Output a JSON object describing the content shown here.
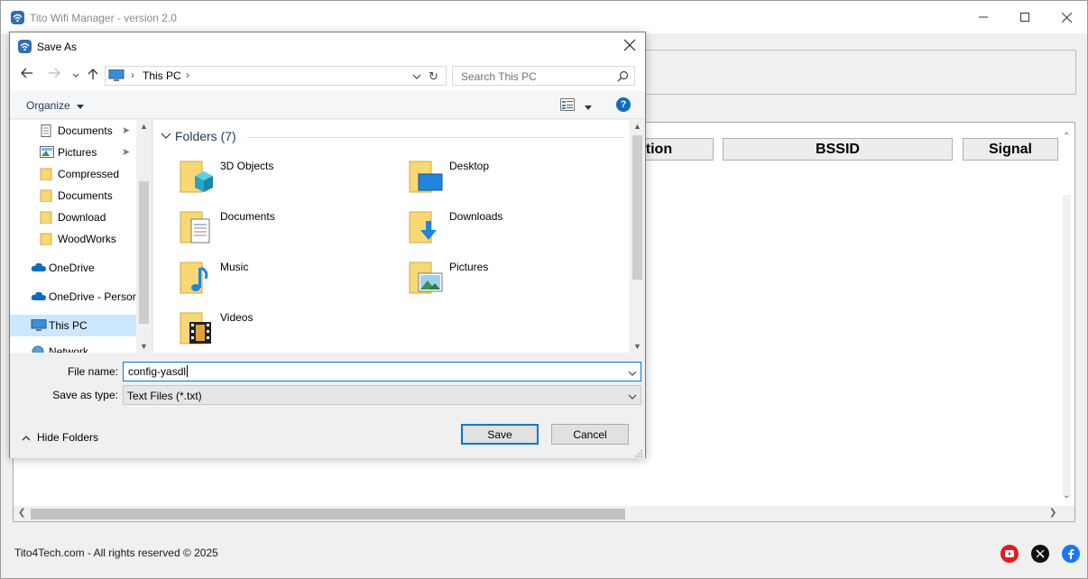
{
  "app": {
    "title": "Tito Wifi Manager - version 2.0",
    "grid_headers": {
      "description_partial": "ption",
      "bssid": "BSSID",
      "signal": "Signal"
    },
    "footer": "Tito4Tech.com - All rights reserved © 2025",
    "social": [
      "youtube-icon",
      "x-icon",
      "facebook-icon"
    ]
  },
  "dialog": {
    "title": "Save As",
    "address": {
      "location": "This PC"
    },
    "search_placeholder": "Search This PC",
    "organize_label": "Organize",
    "nav_tree": [
      {
        "label": "Documents",
        "icon": "documents-icon",
        "pinned": true
      },
      {
        "label": "Pictures",
        "icon": "pictures-icon",
        "pinned": true
      },
      {
        "label": "Compressed",
        "icon": "folder-icon",
        "pinned": false
      },
      {
        "label": "Documents",
        "icon": "folder-icon",
        "pinned": false
      },
      {
        "label": "Download",
        "icon": "folder-icon",
        "pinned": false
      },
      {
        "label": "WoodWorks",
        "icon": "folder-icon",
        "pinned": false
      },
      {
        "label": "OneDrive",
        "icon": "onedrive-icon",
        "pinned": false
      },
      {
        "label": "OneDrive - Person",
        "icon": "onedrive-icon",
        "pinned": false
      },
      {
        "label": "This PC",
        "icon": "pc-icon",
        "pinned": false,
        "selected": true
      },
      {
        "label": "Network",
        "icon": "network-icon",
        "pinned": false
      }
    ],
    "group_header": "Folders (7)",
    "folders": [
      {
        "label": "3D Objects",
        "icon": "3d-objects-folder-icon"
      },
      {
        "label": "Desktop",
        "icon": "desktop-folder-icon"
      },
      {
        "label": "Documents",
        "icon": "documents-folder-icon"
      },
      {
        "label": "Downloads",
        "icon": "downloads-folder-icon"
      },
      {
        "label": "Music",
        "icon": "music-folder-icon"
      },
      {
        "label": "Pictures",
        "icon": "pictures-folder-icon"
      },
      {
        "label": "Videos",
        "icon": "videos-folder-icon"
      }
    ],
    "file_name_label": "File name:",
    "file_name_value": "config-yasdl",
    "save_type_label": "Save as type:",
    "save_type_value": "Text Files (*.txt)",
    "hide_folders_label": "Hide Folders",
    "save_label": "Save",
    "cancel_label": "Cancel"
  },
  "colors": {
    "accent": "#0078d7",
    "folder": "#f8d775",
    "selected_bg": "#cce8ff",
    "youtube": "#e21b1b",
    "facebook": "#1877f2"
  }
}
